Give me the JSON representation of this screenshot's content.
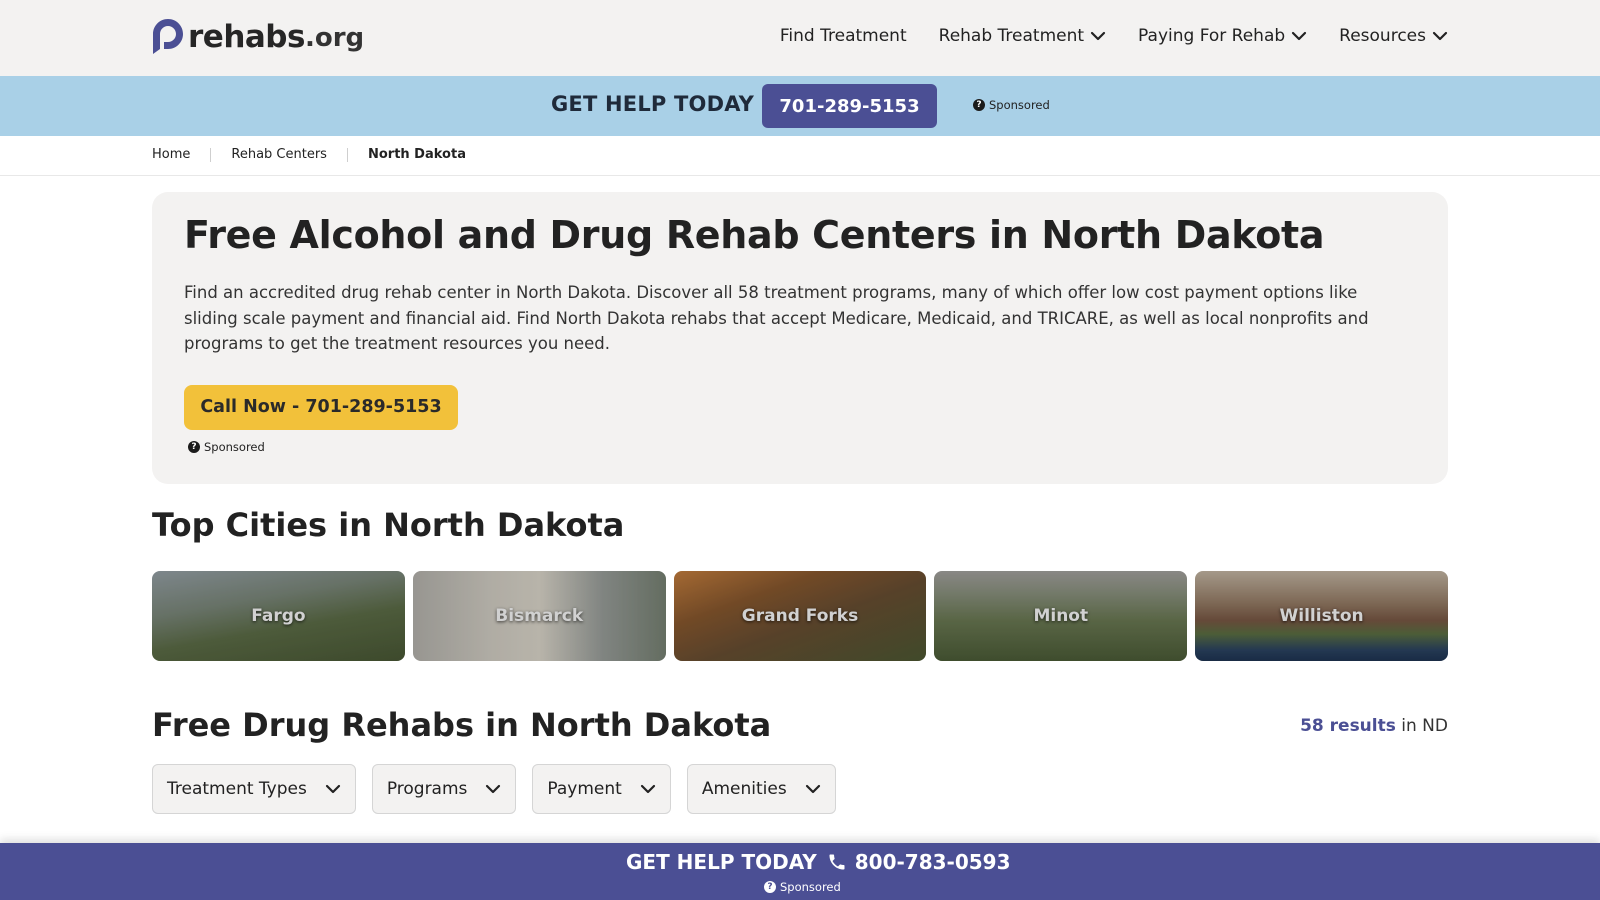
{
  "header": {
    "logo_name": "rehabs",
    "logo_tld": ".org",
    "nav": [
      {
        "label": "Find Treatment",
        "icon": ""
      },
      {
        "label": "Rehab Treatment",
        "icon": "chevron-down-icon"
      },
      {
        "label": "Paying For Rehab",
        "icon": "chevron-down-icon"
      },
      {
        "label": "Resources",
        "icon": "chevron-down-icon"
      }
    ]
  },
  "helpbar": {
    "title": "GET HELP TODAY",
    "phone": "701-289-5153",
    "sponsored": "Sponsored"
  },
  "breadcrumb": [
    "Home",
    "Rehab Centers",
    "North Dakota"
  ],
  "hero": {
    "title": "Free Alcohol and Drug Rehab Centers in North Dakota",
    "description": "Find an accredited drug rehab center in North Dakota. Discover all 58 treatment programs, many of which offer low cost payment options like sliding scale payment and financial aid. Find North Dakota rehabs that accept Medicare, Medicaid, and TRICARE, as well as local nonprofits and programs to get the treatment resources you need.",
    "call_button": "Call Now - 701-289-5153",
    "sponsored": "Sponsored"
  },
  "cities": {
    "title": "Top Cities in North Dakota",
    "items": [
      "Fargo",
      "Bismarck",
      "Grand Forks",
      "Minot",
      "Williston"
    ]
  },
  "rehabs": {
    "title": "Free Drug Rehabs in North Dakota",
    "results_count": "58 results",
    "results_suffix": " in ND",
    "filters": [
      "Treatment Types",
      "Programs",
      "Payment",
      "Amenities"
    ]
  },
  "bottombar": {
    "title": "GET HELP TODAY",
    "phone": "800-783-0593",
    "sponsored": "Sponsored"
  },
  "colors": {
    "brand_purple": "#4b4f94",
    "help_bar": "#a9d0e7",
    "cta_yellow": "#f2c13a",
    "panel_gray": "#f3f2f1"
  }
}
